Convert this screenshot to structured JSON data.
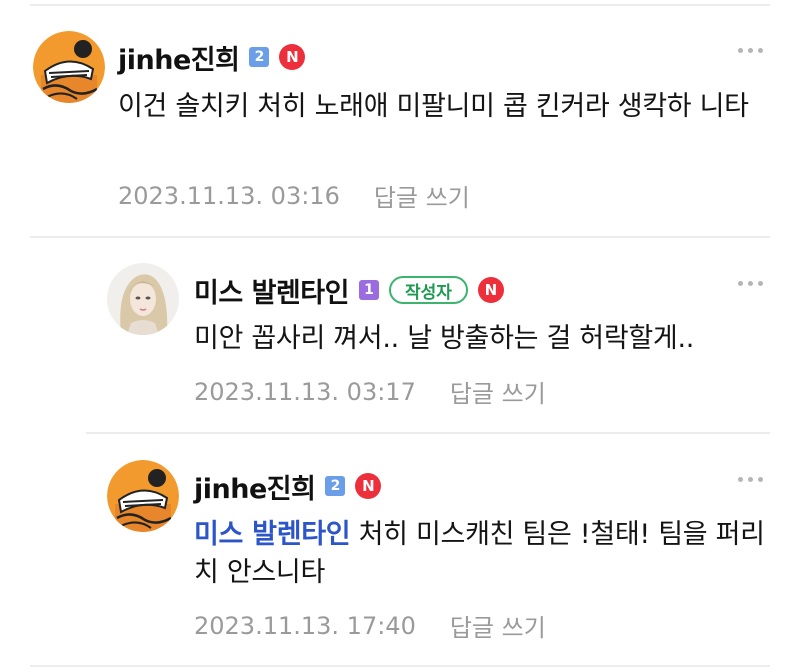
{
  "comments": [
    {
      "nickname": "jinhe진희",
      "level": "2",
      "level_color": "#6a9ee8",
      "badge": "N",
      "author_tag": "",
      "mention": "",
      "text": "이건 솔치키 처히 노래애 미팔니미 콥 킨커라 생칵하 니타",
      "date": "2023.11.13. 03:16",
      "reply_label": "답글 쓰기",
      "avatar_icon": "character-avatar-icon"
    },
    {
      "nickname": "미스 발렌타인",
      "level": "1",
      "level_color": "#9b6be0",
      "badge": "N",
      "author_tag": "작성자",
      "mention": "",
      "text": "미안 꼽사리 껴서.. 날 방출하는 걸 허락할게..",
      "date": "2023.11.13. 03:17",
      "reply_label": "답글 쓰기",
      "avatar_icon": "portrait-avatar-icon"
    },
    {
      "nickname": "jinhe진희",
      "level": "2",
      "level_color": "#6a9ee8",
      "badge": "N",
      "author_tag": "",
      "mention": "미스 발렌타인",
      "text": " 처히 미스캐친 팀은 !철태! 팀을 퍼리치 안스니타",
      "date": "2023.11.13. 17:40",
      "reply_label": "답글 쓰기",
      "avatar_icon": "character-avatar-icon"
    }
  ],
  "colors": {
    "badge_red": "#ec2f3b",
    "author_green": "#3cb46e",
    "mention_blue": "#2c55c7",
    "meta_gray": "#9a9a9a"
  }
}
